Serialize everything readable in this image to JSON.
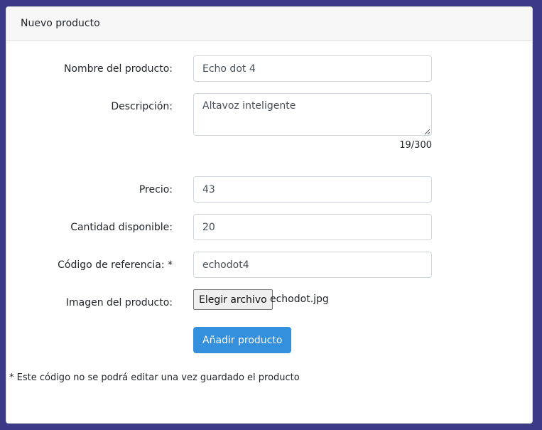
{
  "card": {
    "title": "Nuevo producto"
  },
  "form": {
    "name": {
      "label": "Nombre del producto:",
      "value": "Echo dot 4"
    },
    "description": {
      "label": "Descripción:",
      "value": "Altavoz inteligente",
      "counter": "19/300"
    },
    "price": {
      "label": "Precio:",
      "value": "43"
    },
    "quantity": {
      "label": "Cantidad disponible:",
      "value": "20"
    },
    "reference": {
      "label": "Código de referencia: *",
      "value": "echodot4"
    },
    "image": {
      "label": "Imagen del producto:",
      "button_label": "Elegir archivo",
      "file_name": "echodot.jpg"
    },
    "submit_label": "Añadir producto",
    "note": "* Este código no se podrá editar una vez guardado el producto"
  },
  "colors": {
    "page_background": "#3a3a86",
    "primary_button": "#3490dc"
  }
}
